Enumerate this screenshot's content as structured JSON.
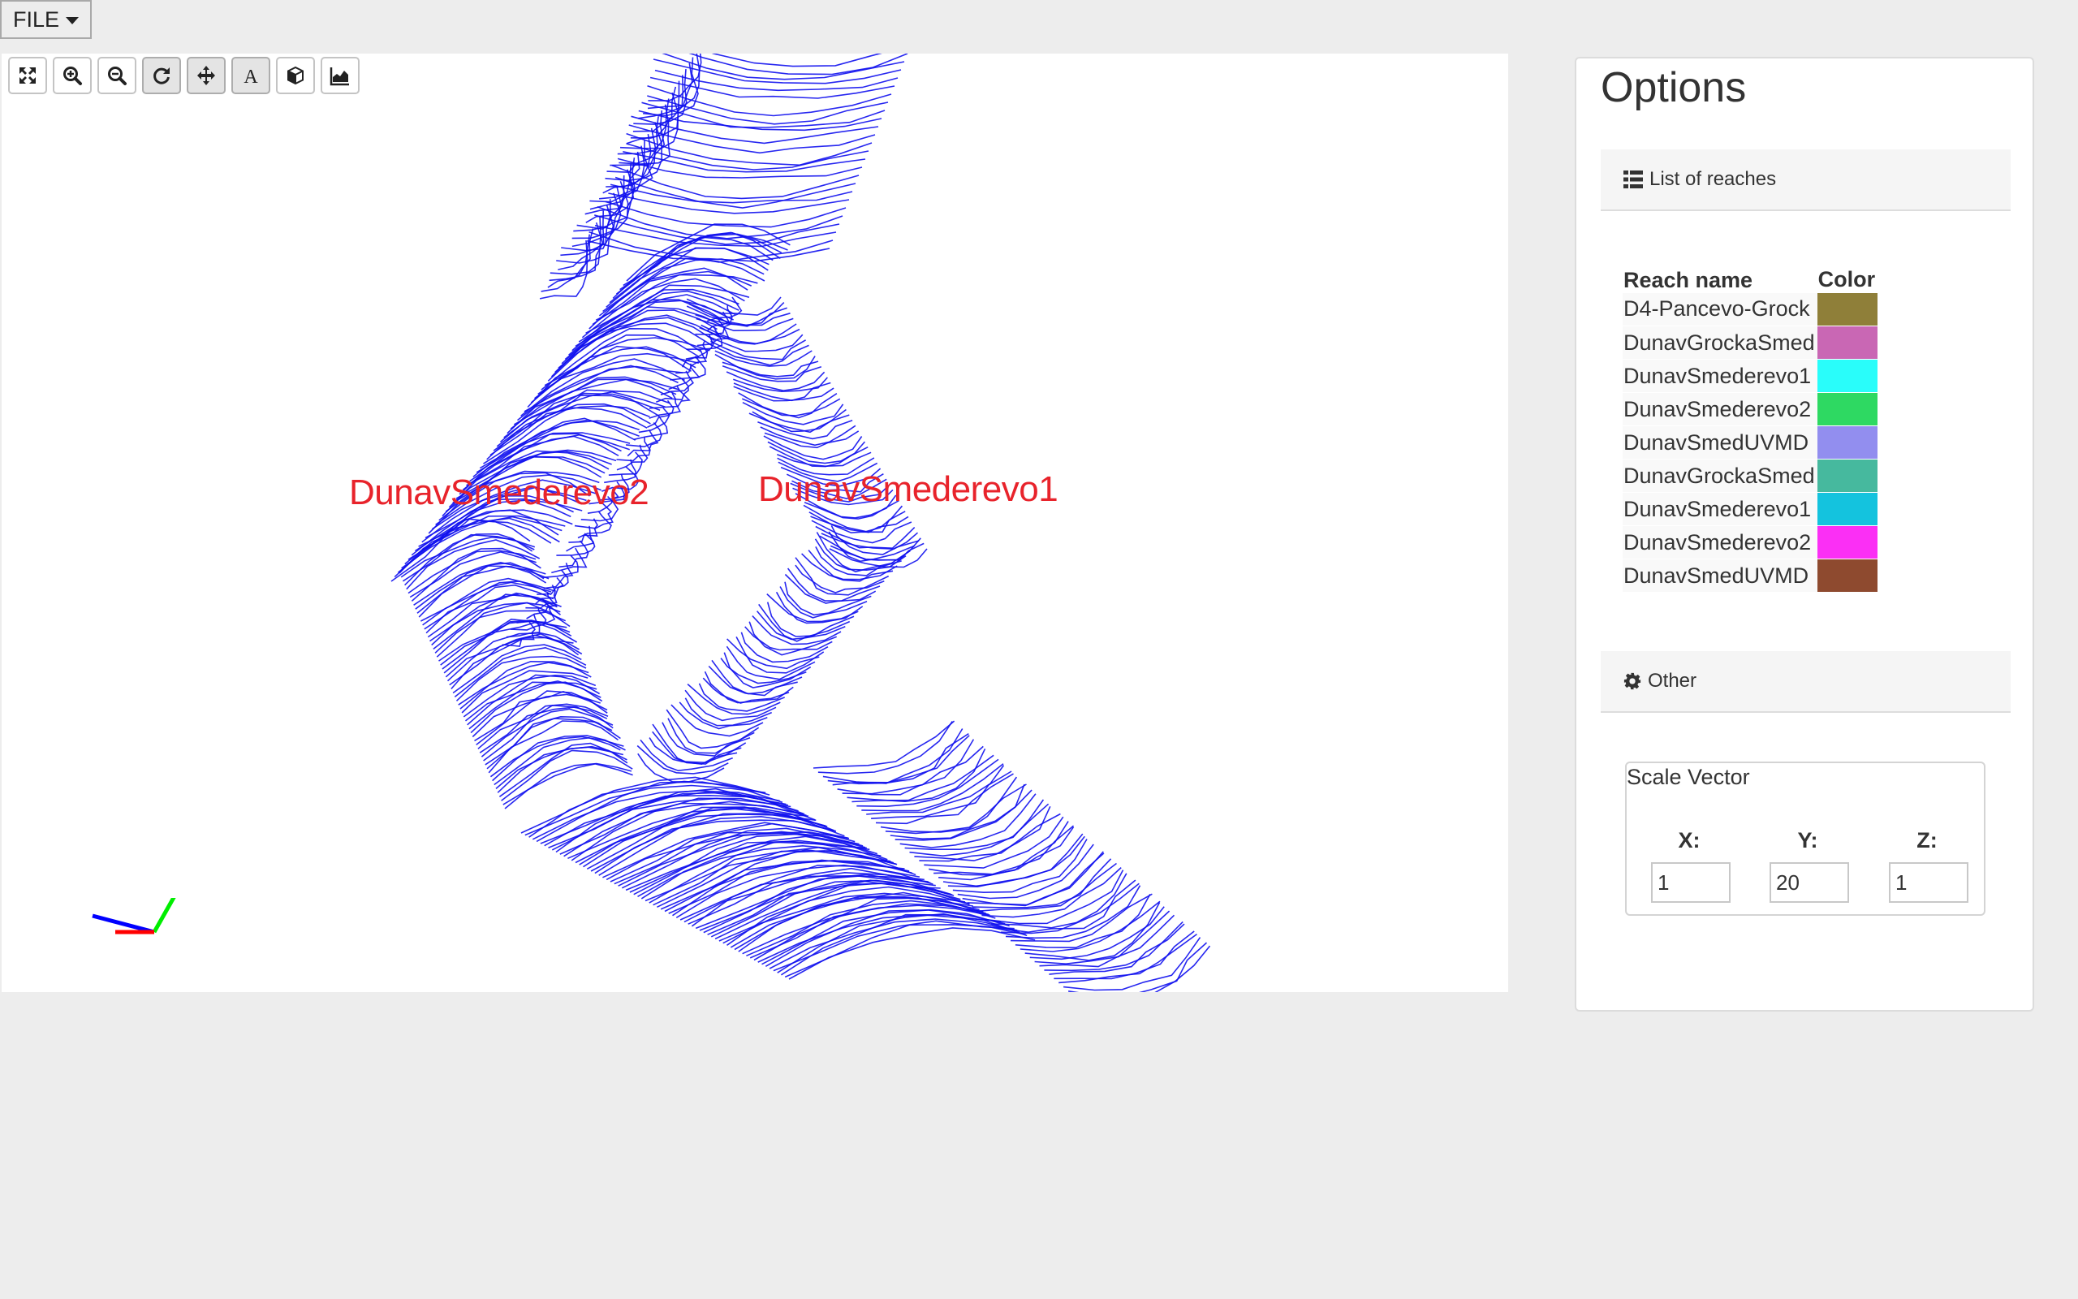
{
  "menu": {
    "file_label": "FILE"
  },
  "toolbar": {
    "tools": [
      {
        "icon": "fit-to-screen-icon"
      },
      {
        "icon": "zoom-in-icon"
      },
      {
        "icon": "zoom-out-icon"
      },
      {
        "icon": "reset-rotation-icon"
      },
      {
        "icon": "pan-move-icon"
      },
      {
        "icon": "text-labels-icon"
      },
      {
        "icon": "cube-view-icon"
      },
      {
        "icon": "area-chart-icon"
      }
    ]
  },
  "viewer": {
    "line_color": "#1010ee",
    "labels": [
      "DunavSmederevo2",
      "DunavSmederevo1"
    ],
    "label_color": "#e8232b",
    "axes_colors": {
      "x": "#ff0000",
      "y": "#00ee00",
      "z": "#0000ff"
    }
  },
  "options": {
    "title": "Options",
    "reaches_section": {
      "label": "List of reaches",
      "icon": "list-icon"
    },
    "table": {
      "headers": [
        "Reach name",
        "Color"
      ],
      "rows": [
        {
          "name": "D4-Pancevo-Grock",
          "color": "#8f7f39"
        },
        {
          "name": "DunavGrockaSmed",
          "color": "#c967b4"
        },
        {
          "name": "DunavSmederevo1",
          "color": "#29fdfa"
        },
        {
          "name": "DunavSmederevo2",
          "color": "#2ed962"
        },
        {
          "name": "DunavSmedUVMD",
          "color": "#928eef"
        },
        {
          "name": "DunavGrockaSmed",
          "color": "#46b99e"
        },
        {
          "name": "DunavSmederevo1",
          "color": "#14c3de"
        },
        {
          "name": "DunavSmederevo2",
          "color": "#fb2ff5"
        },
        {
          "name": "DunavSmedUVMD",
          "color": "#8e4a2f"
        }
      ]
    },
    "other_section": {
      "label": "Other",
      "icon": "gear-icon"
    },
    "scale_vector": {
      "legend": "Scale Vector",
      "x_label": "X:",
      "y_label": "Y:",
      "z_label": "Z:",
      "x_value": "1",
      "y_value": "20",
      "z_value": "1"
    }
  }
}
